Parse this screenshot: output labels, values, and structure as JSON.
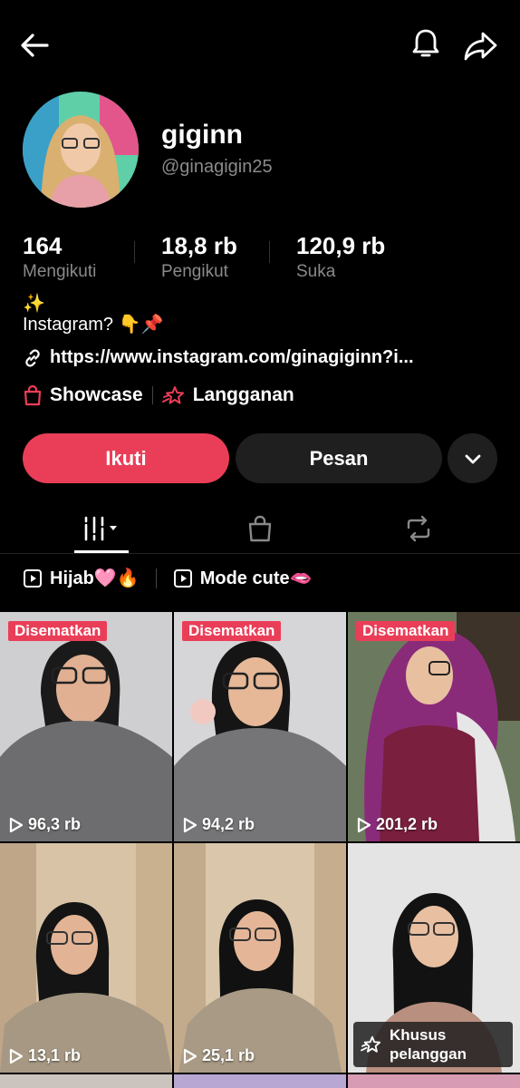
{
  "profile": {
    "name": "giginn",
    "handle": "@ginagigin25",
    "bio_line1": "✨",
    "bio_line2": "Instagram? 👇📌",
    "link": "https://www.instagram.com/ginagiginn?i..."
  },
  "stats": {
    "following": {
      "value": "164",
      "label": "Mengikuti"
    },
    "followers": {
      "value": "18,8 rb",
      "label": "Pengikut"
    },
    "likes": {
      "value": "120,9 rb",
      "label": "Suka"
    }
  },
  "tags": {
    "showcase": "Showcase",
    "subscription": "Langganan"
  },
  "actions": {
    "follow": "Ikuti",
    "message": "Pesan"
  },
  "playlists": [
    "Hijab🩷🔥",
    "Mode cute🫦"
  ],
  "videos": [
    {
      "pinned": "Disematkan",
      "views": "96,3 rb"
    },
    {
      "pinned": "Disematkan",
      "views": "94,2 rb"
    },
    {
      "pinned": "Disematkan",
      "views": "201,2 rb"
    },
    {
      "views": "13,1 rb"
    },
    {
      "views": "25,1 rb"
    },
    {
      "badge": "Khusus pelanggan"
    }
  ],
  "colors": {
    "accent": "#ea3e58",
    "background": "#000000",
    "muted_text": "#8a8a8a",
    "secondary_button": "#1f1f1f"
  }
}
